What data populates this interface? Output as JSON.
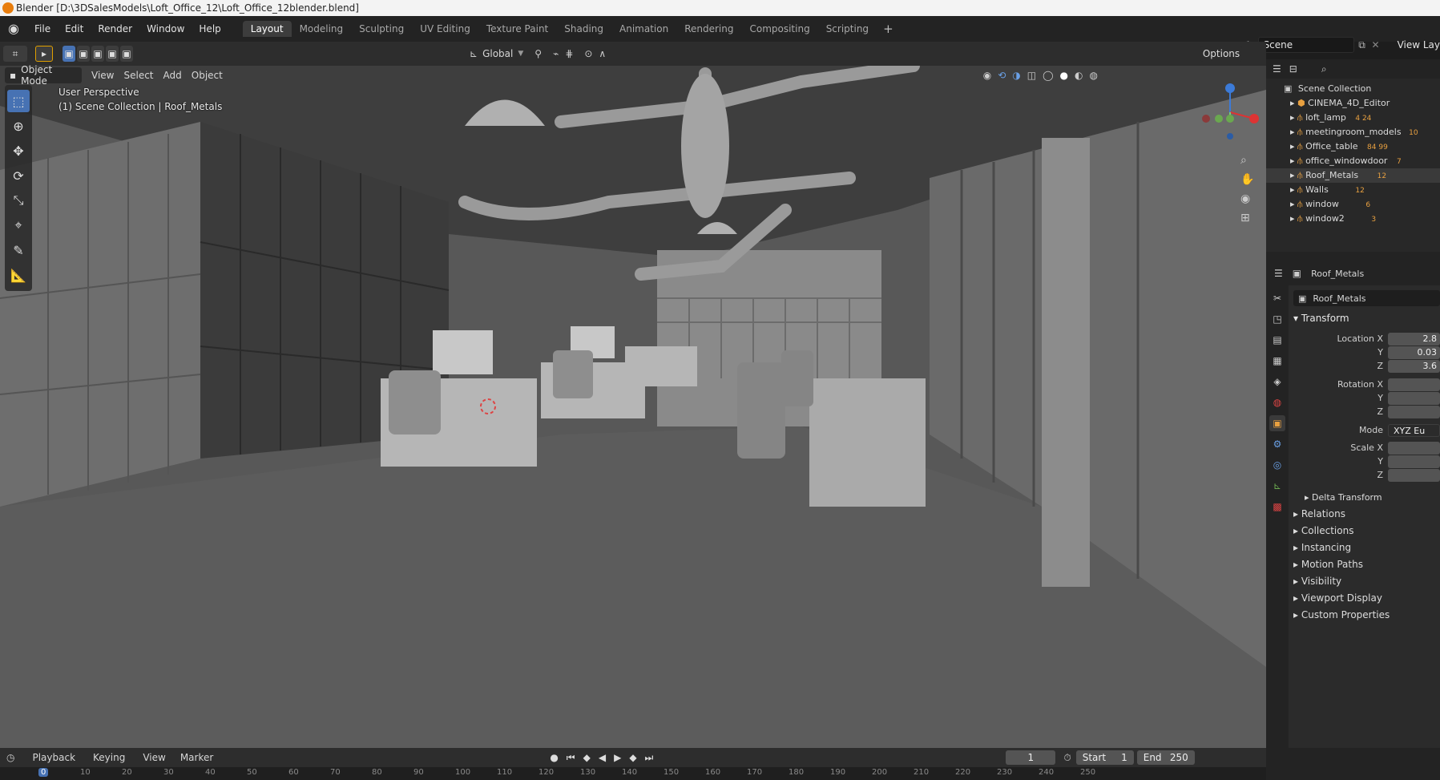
{
  "window": {
    "title": "Blender [D:\\3DSalesModels\\Loft_Office_12\\Loft_Office_12blender.blend]"
  },
  "menu": [
    "File",
    "Edit",
    "Render",
    "Window",
    "Help"
  ],
  "workspaces": [
    "Layout",
    "Modeling",
    "Sculpting",
    "UV Editing",
    "Texture Paint",
    "Shading",
    "Animation",
    "Rendering",
    "Compositing",
    "Scripting"
  ],
  "scene": {
    "label": "Scene",
    "view_layer": "View Lay"
  },
  "viewport": {
    "transform_orientation": "Global",
    "options_label": "Options",
    "mode": "Object Mode",
    "header_menu": [
      "View",
      "Select",
      "Add",
      "Object"
    ],
    "perspective": "User Perspective",
    "collection_info": "(1) Scene Collection | Roof_Metals"
  },
  "outliner": {
    "root": "Scene Collection",
    "items": [
      {
        "name": "CINEMA_4D_Editor"
      },
      {
        "name": "loft_lamp",
        "badge": "4 24"
      },
      {
        "name": "meetingroom_models",
        "badge": "10"
      },
      {
        "name": "Office_table",
        "badge": "84 99"
      },
      {
        "name": "office_windowdoor",
        "badge": "7"
      },
      {
        "name": "Roof_Metals",
        "badge": "12"
      },
      {
        "name": "Walls",
        "badge": "12"
      },
      {
        "name": "window",
        "badge": "6"
      },
      {
        "name": "window2",
        "badge": "3"
      }
    ]
  },
  "properties": {
    "object_name": "Roof_Metals",
    "datablock": "Roof_Metals",
    "transform_header": "Transform",
    "location": {
      "label_x": "Location X",
      "x": "2.8",
      "y": "0.03",
      "z": "3.6"
    },
    "rotation": {
      "label_x": "Rotation X",
      "x": "",
      "y": "",
      "z": ""
    },
    "mode": {
      "label": "Mode",
      "value": "XYZ Eu"
    },
    "scale": {
      "label_x": "Scale X",
      "x": "",
      "y": "",
      "z": ""
    },
    "axis_y": "Y",
    "axis_z": "Z",
    "delta_transform": "Delta Transform",
    "sections": [
      "Relations",
      "Collections",
      "Instancing",
      "Motion Paths",
      "Visibility",
      "Viewport Display",
      "Custom Properties"
    ]
  },
  "timeline": {
    "menu": [
      "Playback",
      "Keying",
      "View",
      "Marker"
    ],
    "current_frame": "1",
    "start_label": "Start",
    "start": "1",
    "end_label": "End",
    "end": "250",
    "ruler": [
      "0",
      "10",
      "20",
      "30",
      "40",
      "50",
      "60",
      "70",
      "80",
      "90",
      "100",
      "110",
      "120",
      "130",
      "140",
      "150",
      "160",
      "170",
      "180",
      "190",
      "200",
      "210",
      "220",
      "230",
      "240",
      "250"
    ]
  }
}
